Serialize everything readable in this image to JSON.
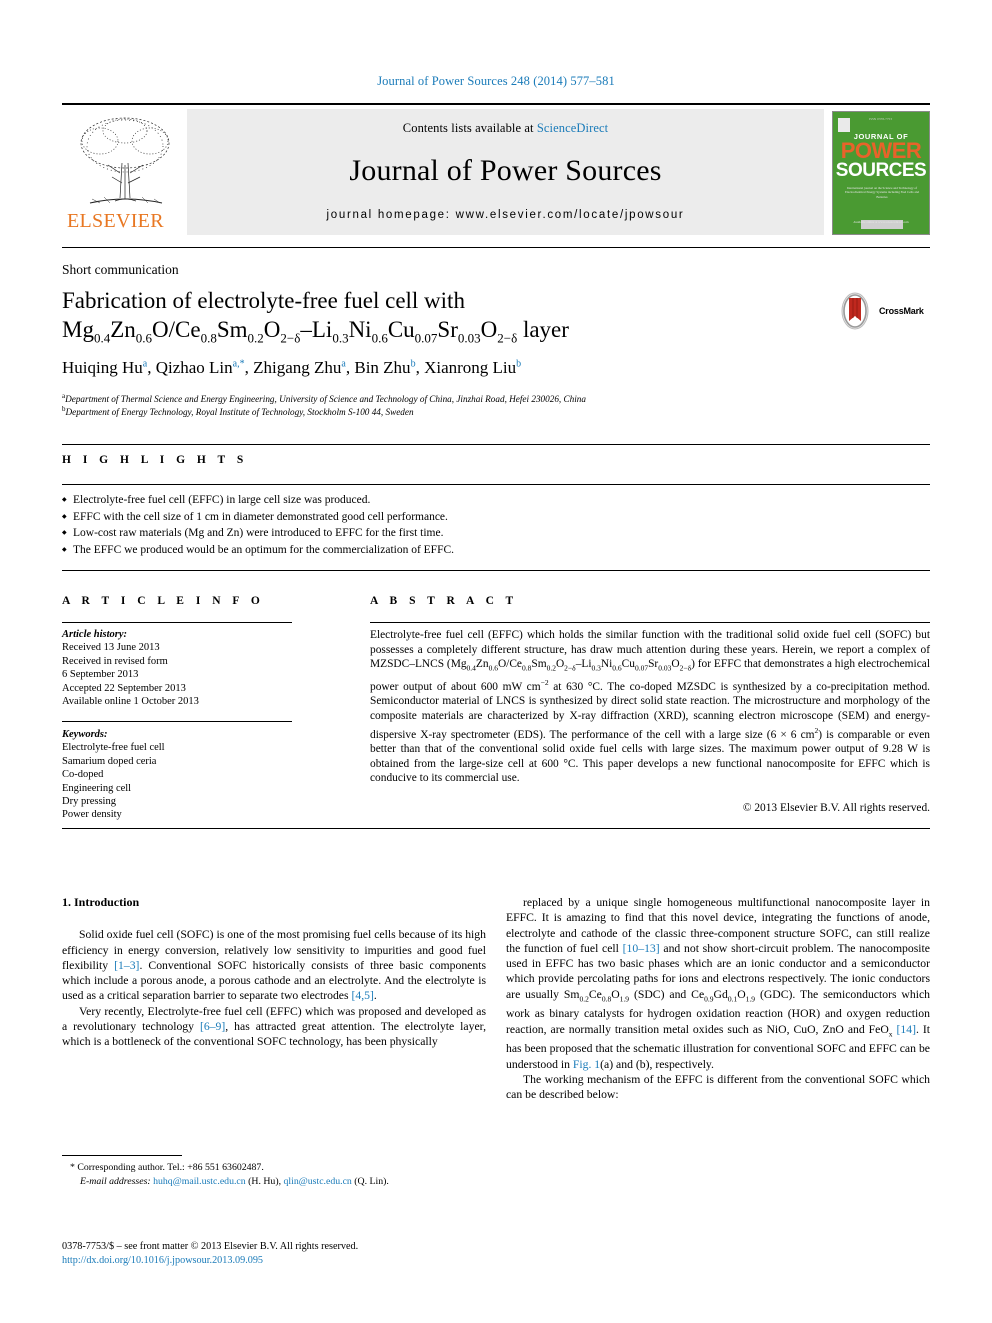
{
  "running_head": "Journal of Power Sources 248 (2014) 577–581",
  "masthead": {
    "contents_prefix": "Contents lists available at ",
    "sciencedirect": "ScienceDirect",
    "journal_name": "Journal of Power Sources",
    "homepage": "journal homepage: www.elsevier.com/locate/jpowsour",
    "publisher": "ELSEVIER",
    "cover": {
      "top_line": "ISSN 0378-7753",
      "journal_of": "JOURNAL OF",
      "power": "POWER",
      "sources": "SOURCES",
      "blurb": "International journal on the Science and Technology of Electrochemical Energy Systems including Fuel Cells and Batteries",
      "footer": "Available online at www.sciencedirect.com"
    },
    "accent_orange": "#e87722",
    "accent_blue": "#1a7bb9",
    "cover_green": "#4a9a32"
  },
  "article": {
    "type": "Short communication",
    "title_line1": "Fabrication of electrolyte-free fuel cell with",
    "title_formula": [
      {
        "t": "Mg"
      },
      {
        "sub": "0.4"
      },
      {
        "t": "Zn"
      },
      {
        "sub": "0.6"
      },
      {
        "t": "O/Ce"
      },
      {
        "sub": "0.8"
      },
      {
        "t": "Sm"
      },
      {
        "sub": "0.2"
      },
      {
        "t": "O"
      },
      {
        "sub": "2−δ"
      },
      {
        "t": "–Li"
      },
      {
        "sub": "0.3"
      },
      {
        "t": "Ni"
      },
      {
        "sub": "0.6"
      },
      {
        "t": "Cu"
      },
      {
        "sub": "0.07"
      },
      {
        "t": "Sr"
      },
      {
        "sub": "0.03"
      },
      {
        "t": "O"
      },
      {
        "sub": "2−δ"
      },
      {
        "t": " layer"
      }
    ],
    "crossmark_label": "CrossMark",
    "authors": [
      {
        "name": "Huiqing Hu",
        "mark": "a"
      },
      {
        "name": "Qizhao Lin",
        "mark": "a,*"
      },
      {
        "name": "Zhigang Zhu",
        "mark": "a"
      },
      {
        "name": "Bin Zhu",
        "mark": "b"
      },
      {
        "name": "Xianrong Liu",
        "mark": "b"
      }
    ],
    "affiliations": [
      {
        "mark": "a",
        "text": "Department of Thermal Science and Energy Engineering, University of Science and Technology of China, Jinzhai Road, Hefei 230026, China"
      },
      {
        "mark": "b",
        "text": "Department of Energy Technology, Royal Institute of Technology, Stockholm S-100 44, Sweden"
      }
    ]
  },
  "highlights": {
    "heading": "H I G H L I G H T S",
    "items": [
      "Electrolyte-free fuel cell (EFFC) in large cell size was produced.",
      "EFFC with the cell size of 1 cm in diameter demonstrated good cell performance.",
      "Low-cost raw materials (Mg and Zn) were introduced to EFFC for the first time.",
      "The EFFC we produced would be an optimum for the commercialization of EFFC."
    ]
  },
  "article_info": {
    "heading": "A R T I C L E   I N F O",
    "history_label": "Article history:",
    "history": [
      "Received 13 June 2013",
      "Received in revised form",
      "6 September 2013",
      "Accepted 22 September 2013",
      "Available online 1 October 2013"
    ],
    "keywords_label": "Keywords:",
    "keywords": [
      "Electrolyte-free fuel cell",
      "Samarium doped ceria",
      "Co-doped",
      "Engineering cell",
      "Dry pressing",
      "Power density"
    ]
  },
  "abstract": {
    "heading": "A B S T R A C T",
    "copyright": "© 2013 Elsevier B.V. All rights reserved.",
    "parts": [
      {
        "t": "Electrolyte-free fuel cell (EFFC) which holds the similar function with the traditional solid oxide fuel cell (SOFC) but possesses a completely different structure, has draw much attention during these years. Herein, we report a complex of MZSDC–LNCS (Mg"
      },
      {
        "sub": "0.4"
      },
      {
        "t": "Zn"
      },
      {
        "sub": "0.6"
      },
      {
        "t": "O/Ce"
      },
      {
        "sub": "0.8"
      },
      {
        "t": "Sm"
      },
      {
        "sub": "0.2"
      },
      {
        "t": "O"
      },
      {
        "sub": "2−δ"
      },
      {
        "t": "–Li"
      },
      {
        "sub": "0.3"
      },
      {
        "t": "Ni"
      },
      {
        "sub": "0.6"
      },
      {
        "t": "Cu"
      },
      {
        "sub": "0.07"
      },
      {
        "t": "Sr"
      },
      {
        "sub": "0.03"
      },
      {
        "t": "O"
      },
      {
        "sub": "2−δ"
      },
      {
        "t": ") for EFFC that demonstrates a high electrochemical power output of about 600 mW cm"
      },
      {
        "sup": "−2"
      },
      {
        "t": " at 630 °C. The co-doped MZSDC is synthesized by a co-precipitation method. Semiconductor material of LNCS is synthesized by direct solid state reaction. The microstructure and morphology of the composite materials are characterized by X-ray diffraction (XRD), scanning electron microscope (SEM) and energy-dispersive X-ray spectrometer (EDS). The performance of the cell with a large size (6 × 6 cm"
      },
      {
        "sup": "2"
      },
      {
        "t": ") is comparable or even better than that of the conventional solid oxide fuel cells with large sizes. The maximum power output of 9.28 W is obtained from the large-size cell at 600 °C. This paper develops a new functional nanocomposite for EFFC which is conducive to its commercial use."
      }
    ]
  },
  "body": {
    "section_heading": "1.  Introduction",
    "left_paras": [
      [
        {
          "t": "Solid oxide fuel cell (SOFC) is one of the most promising fuel cells because of its high efficiency in energy conversion, relatively low sensitivity to impurities and good fuel flexibility "
        },
        {
          "ref": "[1–3]"
        },
        {
          "t": ". Conventional SOFC historically consists of three basic components which include a porous anode, a porous cathode and an electrolyte. And the electrolyte is used as a critical separation barrier to separate two electrodes "
        },
        {
          "ref": "[4,5]"
        },
        {
          "t": "."
        }
      ],
      [
        {
          "t": "Very recently, Electrolyte-free fuel cell (EFFC) which was proposed and developed as a revolutionary technology "
        },
        {
          "ref": "[6–9]"
        },
        {
          "t": ", has attracted great attention. The electrolyte layer, which is a bottleneck of the conventional SOFC technology, has been physically"
        }
      ]
    ],
    "right_paras": [
      [
        {
          "t": "replaced by a unique single homogeneous multifunctional nanocomposite layer in EFFC. It is amazing to find that this novel device, integrating the functions of anode, electrolyte and cathode of the classic three-component structure SOFC, can still realize the function of fuel cell "
        },
        {
          "ref": "[10–13]"
        },
        {
          "t": " and not show short-circuit problem. The nanocomposite used in EFFC has two basic phases which are an ionic conductor and a semiconductor which provide percolating paths for ions and electrons respectively. The ionic conductors are usually Sm"
        },
        {
          "sub": "0.2"
        },
        {
          "t": "Ce"
        },
        {
          "sub": "0.8"
        },
        {
          "t": "O"
        },
        {
          "sub": "1.9"
        },
        {
          "t": " (SDC) and Ce"
        },
        {
          "sub": "0.9"
        },
        {
          "t": "Gd"
        },
        {
          "sub": "0.1"
        },
        {
          "t": "O"
        },
        {
          "sub": "1.9"
        },
        {
          "t": " (GDC). The semiconductors which work as binary catalysts for hydrogen oxidation reaction (HOR) and oxygen reduction reaction, are normally transition metal oxides such as NiO, CuO, ZnO and FeO"
        },
        {
          "sub": "x"
        },
        {
          "t": " "
        },
        {
          "ref": "[14]"
        },
        {
          "t": ". It has been proposed that the schematic illustration for conventional SOFC and EFFC can be understood in "
        },
        {
          "ref": "Fig. 1"
        },
        {
          "t": "(a) and (b), respectively."
        }
      ],
      [
        {
          "t": "The working mechanism of the EFFC is different from the conventional SOFC which can be described below:"
        }
      ]
    ]
  },
  "footnotes": {
    "corresponding": "* Corresponding author. Tel.: +86 551 63602487.",
    "email_label": "E-mail addresses:",
    "emails": [
      {
        "addr": "huhq@mail.ustc.edu.cn",
        "who": "(H. Hu)"
      },
      {
        "addr": "qlin@ustc.edu.cn",
        "who": "(Q. Lin)"
      }
    ],
    "issn_line": "0378-7753/$ – see front matter © 2013 Elsevier B.V. All rights reserved.",
    "doi": "http://dx.doi.org/10.1016/j.jpowsour.2013.09.095"
  }
}
